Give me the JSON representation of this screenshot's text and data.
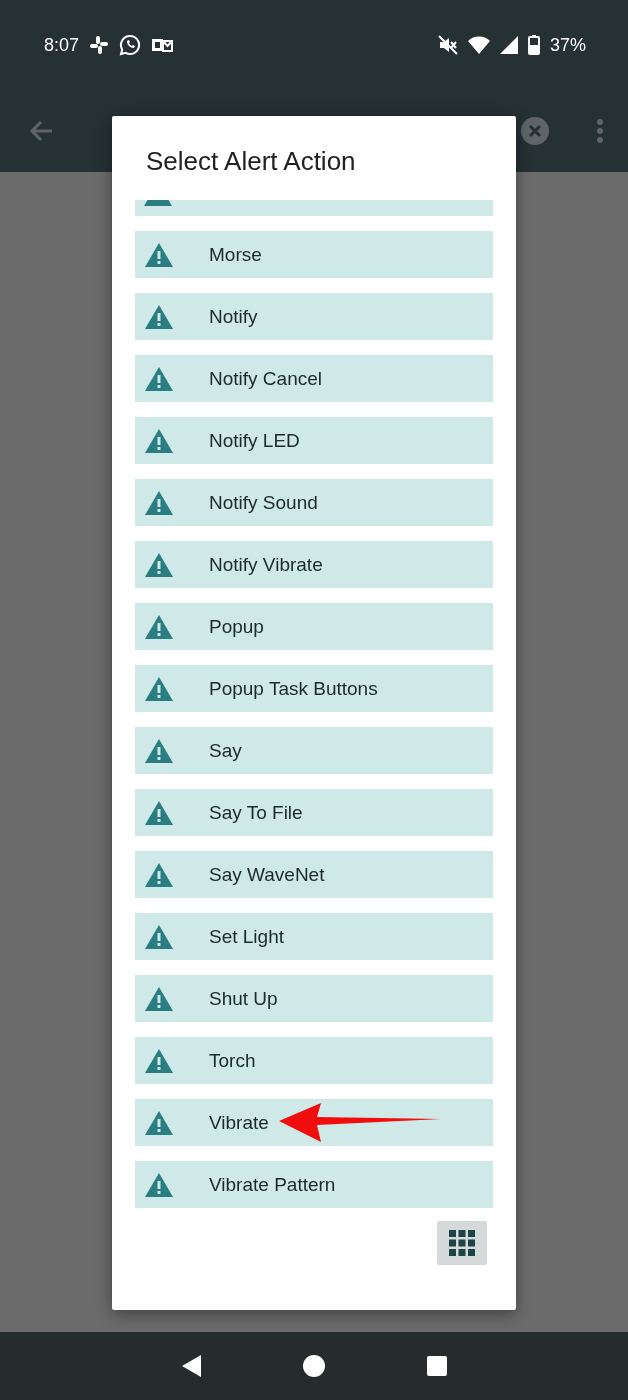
{
  "status_bar": {
    "time": "8:07",
    "battery": "37%"
  },
  "dialog": {
    "title": "Select Alert Action",
    "items": [
      {
        "label": "Morse",
        "marked": false
      },
      {
        "label": "Notify",
        "marked": false
      },
      {
        "label": "Notify Cancel",
        "marked": false
      },
      {
        "label": "Notify LED",
        "marked": false
      },
      {
        "label": "Notify Sound",
        "marked": false
      },
      {
        "label": "Notify Vibrate",
        "marked": false
      },
      {
        "label": "Popup",
        "marked": false
      },
      {
        "label": "Popup Task Buttons",
        "marked": false
      },
      {
        "label": "Say",
        "marked": false
      },
      {
        "label": "Say To File",
        "marked": false
      },
      {
        "label": "Say WaveNet",
        "marked": false
      },
      {
        "label": "Set Light",
        "marked": false
      },
      {
        "label": "Shut Up",
        "marked": false
      },
      {
        "label": "Torch",
        "marked": false
      },
      {
        "label": "Vibrate",
        "marked": true
      },
      {
        "label": "Vibrate Pattern",
        "marked": false
      }
    ]
  }
}
